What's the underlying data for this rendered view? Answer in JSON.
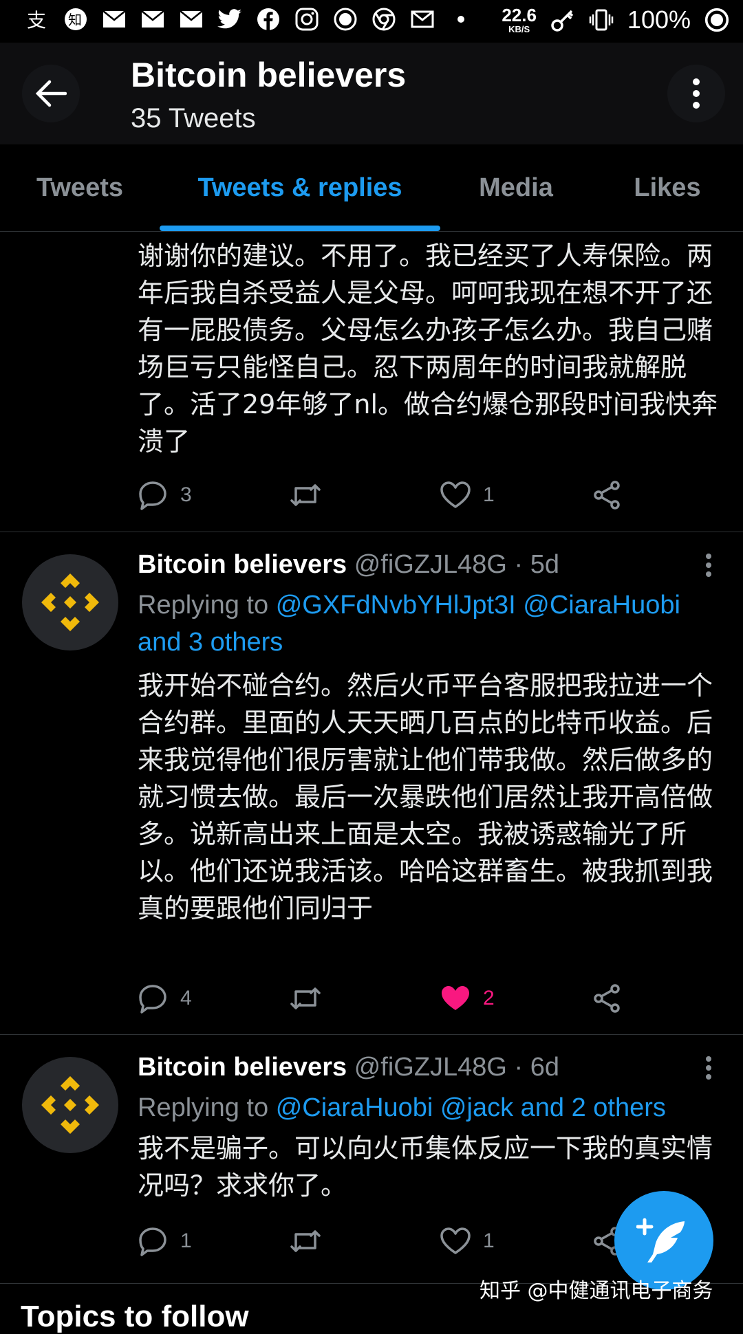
{
  "status_bar": {
    "icons": [
      "alipay-icon",
      "zhihu-icon",
      "mail-icon",
      "mail-icon",
      "mail-icon",
      "twitter-icon",
      "facebook-icon",
      "instagram-icon",
      "record-icon",
      "chrome-icon",
      "mail-outline-icon",
      "dot-icon"
    ],
    "net_speed": "22.6",
    "net_unit": "KB/S",
    "battery": "100%"
  },
  "header": {
    "title": "Bitcoin believers",
    "subtitle": "35 Tweets"
  },
  "tabs": [
    {
      "label": "Tweets"
    },
    {
      "label": "Tweets & replies"
    },
    {
      "label": "Media"
    },
    {
      "label": "Likes"
    }
  ],
  "tweets": [
    {
      "text": "谢谢你的建议。不用了。我已经买了人寿保险。两年后我自杀受益人是父母。呵呵我现在想不开了还有一屁股债务。父母怎么办孩子怎么办。我自己赌场巨亏只能怪自己。忍下两周年的时间我就解脱了。活了29年够了nl。做合约爆仓那段时间我快奔溃了",
      "replies": "3",
      "retweets": "",
      "likes": "1",
      "liked": false
    },
    {
      "name": "Bitcoin believers",
      "handle": "@fiGZJL48G · 5d",
      "replying_prefix": "Replying to",
      "mentions": [
        "@GXFdNvbYHlJpt3I",
        "@CiaraHuobi",
        "and 3 others"
      ],
      "text": "我开始不碰合约。然后火币平台客服把我拉进一个合约群。里面的人天天晒几百点的比特币收益。后来我觉得他们很厉害就让他们带我做。然后做多的就习惯去做。最后一次暴跌他们居然让我开高倍做多。说新高出来上面是太空。我被诱惑输光了所以。他们还说我活该。哈哈这群畜生。被我抓到我真的要跟他们同归于",
      "replies": "4",
      "retweets": "",
      "likes": "2",
      "liked": true
    },
    {
      "name": "Bitcoin believers",
      "handle": "@fiGZJL48G · 6d",
      "replying_prefix": "Replying to",
      "mentions": [
        "@CiaraHuobi",
        "@jack and 2 others"
      ],
      "text": "我不是骗子。可以向火币集体反应一下我的真实情况吗？求求你了。",
      "replies": "1",
      "retweets": "",
      "likes": "1",
      "liked": false
    }
  ],
  "watermark": "知乎 @中健通讯电子商务",
  "next_section_title": "Topics to follow",
  "colors": {
    "accent": "#1d9bf0",
    "like": "#f91880",
    "muted": "#8b9197",
    "binance": "#f0b90b"
  }
}
